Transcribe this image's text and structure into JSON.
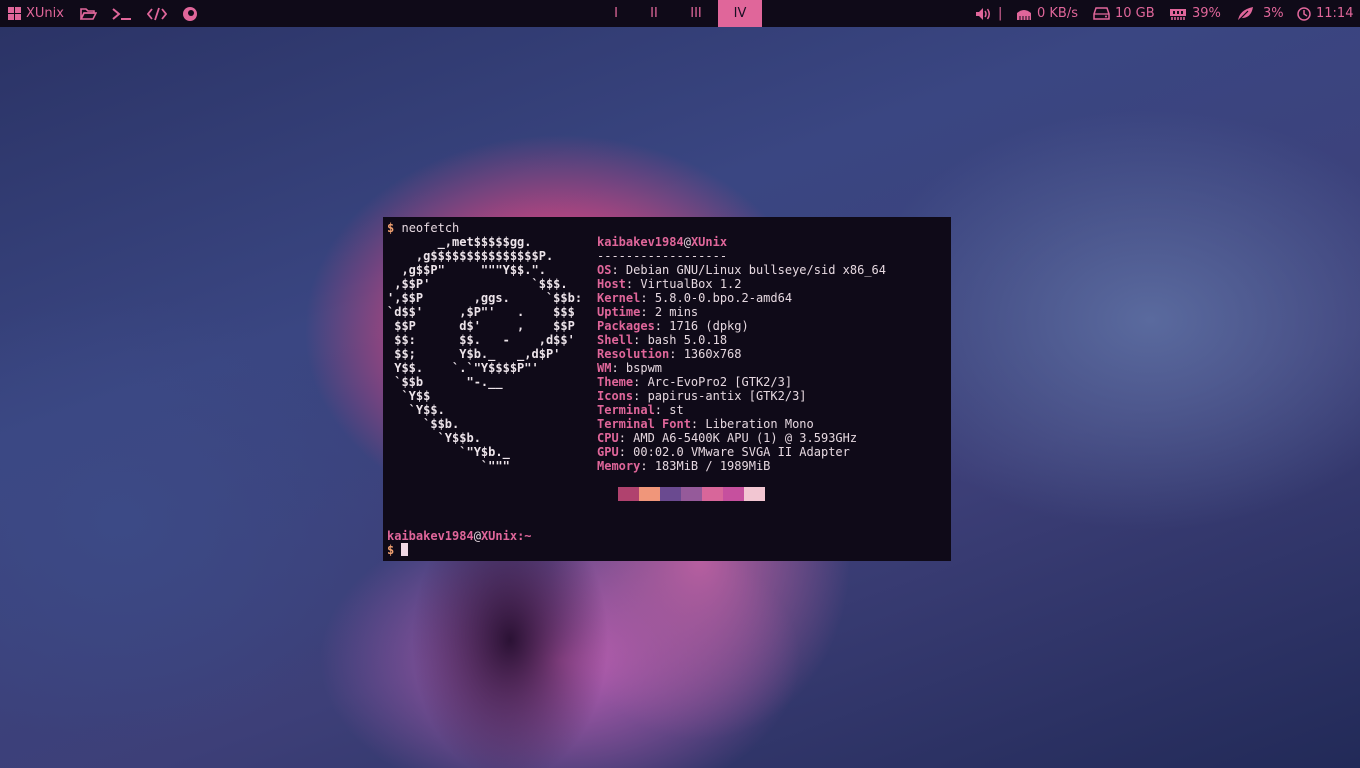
{
  "topbar": {
    "menu_label": "XUnix",
    "workspaces": [
      "I",
      "II",
      "III",
      "IV"
    ],
    "active_workspace": "IV",
    "volume_separator": "|",
    "network": "0 KB/s",
    "disk": "10 GB",
    "memory": "39%",
    "cpu": "3%",
    "clock": "11:14",
    "accent_color": "#e0669a"
  },
  "terminal": {
    "prompt_symbol": "$",
    "command": "neofetch",
    "ascii": [
      "       _,met$$$$$gg.",
      "    ,g$$$$$$$$$$$$$$$P.",
      "  ,g$$P\"     \"\"\"Y$$.\".",
      " ,$$P'              `$$$.",
      "',$$P       ,ggs.     `$$b:",
      "`d$$'     ,$P\"'   .    $$$",
      " $$P      d$'     ,    $$P",
      " $$:      $$.   -    ,d$$'",
      " $$;      Y$b._   _,d$P'",
      " Y$$.    `.`\"Y$$$$P\"'",
      " `$$b      \"-.__",
      "  `Y$$",
      "   `Y$$.",
      "     `$$b.",
      "       `Y$$b.",
      "          `\"Y$b._",
      "             `\"\"\""
    ],
    "user": "kaibakev1984",
    "host": "XUnix",
    "separator": "------------------",
    "info": [
      {
        "key": "OS",
        "value": "Debian GNU/Linux bullseye/sid x86_64"
      },
      {
        "key": "Host",
        "value": "VirtualBox 1.2"
      },
      {
        "key": "Kernel",
        "value": "5.8.0-0.bpo.2-amd64"
      },
      {
        "key": "Uptime",
        "value": "2 mins"
      },
      {
        "key": "Packages",
        "value": "1716 (dpkg)"
      },
      {
        "key": "Shell",
        "value": "bash 5.0.18"
      },
      {
        "key": "Resolution",
        "value": "1360x768"
      },
      {
        "key": "WM",
        "value": "bspwm"
      },
      {
        "key": "Theme",
        "value": "Arc-EvoPro2 [GTK2/3]"
      },
      {
        "key": "Icons",
        "value": "papirus-antix [GTK2/3]"
      },
      {
        "key": "Terminal",
        "value": "st"
      },
      {
        "key": "Terminal Font",
        "value": "Liberation Mono"
      },
      {
        "key": "CPU",
        "value": "AMD A6-5400K APU (1) @ 3.593GHz"
      },
      {
        "key": "GPU",
        "value": "00:02.0 VMware SVGA II Adapter"
      },
      {
        "key": "Memory",
        "value": "183MiB / 1989MiB"
      }
    ],
    "palette": [
      "#b0426e",
      "#f0967a",
      "#6a4a90",
      "#955a9a",
      "#d8669a",
      "#c6509e",
      "#f2c6d2"
    ],
    "prompt_path": "~"
  }
}
